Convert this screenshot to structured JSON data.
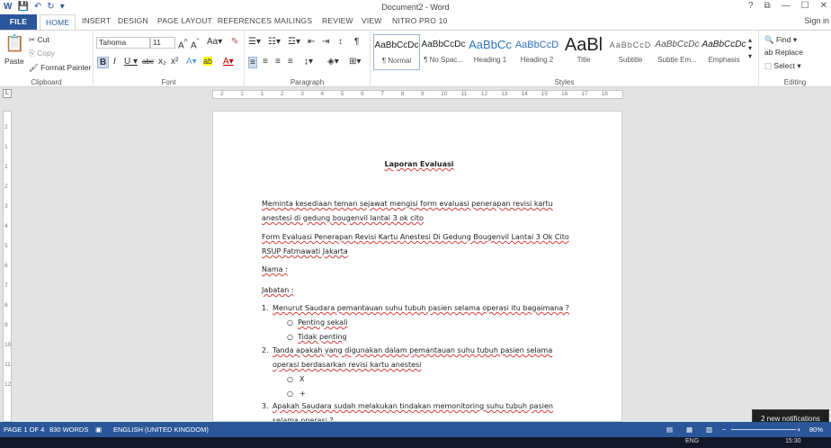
{
  "window": {
    "title": "Document2 - Word",
    "signin": "Sign in",
    "help": "?",
    "restore": "⧉",
    "minimize": "—",
    "maximize": "☐",
    "close": "✕"
  },
  "qat": {
    "save": "💾",
    "undo": "↶",
    "redo": "↻",
    "more": "▾"
  },
  "tabs": [
    "FILE",
    "HOME",
    "INSERT",
    "DESIGN",
    "PAGE LAYOUT",
    "REFERENCES",
    "MAILINGS",
    "REVIEW",
    "VIEW",
    "NITRO PRO 10"
  ],
  "ribbon": {
    "clipboard": {
      "label": "Clipboard",
      "paste": "Paste",
      "cut": "Cut",
      "copy": "Copy",
      "format_painter": "Format Painter"
    },
    "font": {
      "label": "Font",
      "family": "Tahoma",
      "size": "11"
    },
    "paragraph": {
      "label": "Paragraph"
    },
    "styles": {
      "label": "Styles",
      "items": [
        {
          "preview": "AaBbCcDc",
          "name": "¶ Normal"
        },
        {
          "preview": "AaBbCcDc",
          "name": "¶ No Spac..."
        },
        {
          "preview": "AaBbCc",
          "name": "Heading 1"
        },
        {
          "preview": "AaBbCcD",
          "name": "Heading 2"
        },
        {
          "preview": "AaBl",
          "name": "Title"
        },
        {
          "preview": "AaBbCcD",
          "name": "Subtitle"
        },
        {
          "preview": "AaBbCcDc",
          "name": "Subtle Em..."
        },
        {
          "preview": "AaBbCcDc",
          "name": "Emphasis"
        }
      ]
    },
    "editing": {
      "label": "Editing",
      "find": "Find",
      "replace": "Replace",
      "select": "Select"
    }
  },
  "ruler": [
    "2",
    "1",
    "1",
    "2",
    "3",
    "4",
    "5",
    "6",
    "7",
    "8",
    "9",
    "10",
    "11",
    "12",
    "13",
    "14",
    "15",
    "16",
    "17",
    "18"
  ],
  "vruler": [
    "2",
    "1",
    "1",
    "2",
    "3",
    "4",
    "5",
    "6",
    "7",
    "8",
    "9",
    "10",
    "11",
    "12"
  ],
  "document": {
    "title": "Laporan Evaluasi",
    "intro": "Meminta kesediaan teman sejawat mengisi form evaluasi penerapan revisi kartu anestesi di gedung bougenvil lantai 3 ok cito",
    "form_title": "Form Evaluasi Penerapan Revisi Kartu Anestesi Di Gedung Bougenvil Lantai 3 Ok Cito RSUP Fatmawati Jakarta",
    "field_name": "Nama :",
    "field_position": "Jabatan :",
    "q1": "Menurut Saudara pemantauan suhu tubuh pasien selama operasi itu bagaimana ?",
    "q1_opts": [
      "Penting sekali",
      "Tidak penting"
    ],
    "q2": "Tanda apakah yang digunakan dalam pemantauan suhu tubuh pasien selama operasi berdasarkan revisi kartu anestesi",
    "q2_opts": [
      "X",
      "+"
    ],
    "q3": "Apakah Saudara sudah melakukan tindakan memonitoring suhu tubuh pasien selama operasi ?"
  },
  "status": {
    "page": "PAGE 1 OF 4",
    "words": "830 WORDS",
    "lang": "ENGLISH (UNITED KINGDOM)",
    "zoom": "80%"
  },
  "notification": "2 new notifications",
  "taskbar": {
    "lang": "ENG",
    "time": "15:30"
  },
  "colors": {
    "accent": "#2b579a",
    "spell": "#d43b3b"
  }
}
